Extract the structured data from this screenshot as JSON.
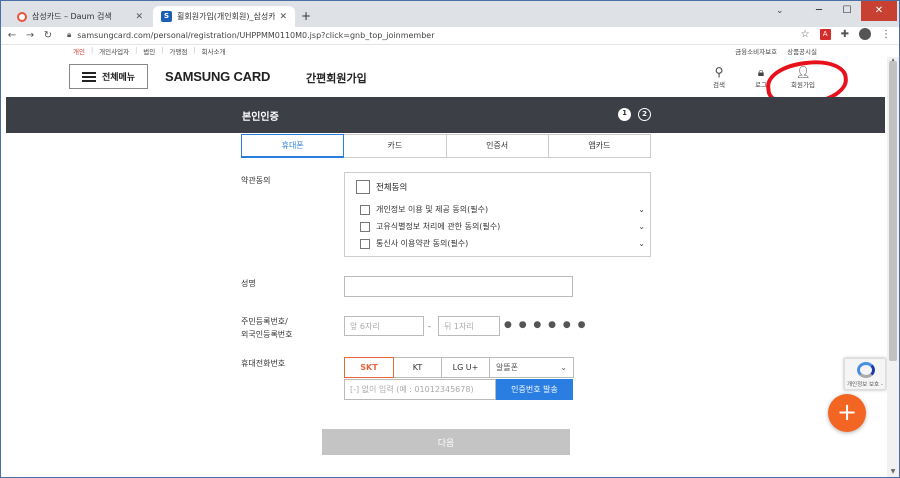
{
  "browser": {
    "tabs": [
      {
        "title": "삼성카드 – Daum 검색",
        "active": false
      },
      {
        "title": "휠회원가입(개인회원)_삼성카드",
        "active": true
      }
    ],
    "new_tab": "+",
    "url": "samsungcard.com/personal/registration/UHPPMM0110M0.jsp?click=gnb_top_joinmember"
  },
  "top_links": {
    "left": [
      "개인",
      "개인사업자",
      "법인",
      "가맹점",
      "회사소개"
    ],
    "right": [
      "금융소비자보호",
      "상품공시실"
    ]
  },
  "header": {
    "menu_label": "전체메뉴",
    "logo": "SAMSUNG CARD",
    "page_title": "간편회원가입",
    "icons": [
      {
        "label": "검색",
        "icon": "search-icon"
      },
      {
        "label": "로그",
        "icon": "lock-icon"
      },
      {
        "label": "회원가입",
        "icon": "person-add-icon"
      }
    ]
  },
  "section": {
    "title": "본인인증",
    "steps": [
      "1",
      "2"
    ]
  },
  "auth_tabs": [
    "휴대폰",
    "카드",
    "인증서",
    "앱카드"
  ],
  "form": {
    "terms_label": "약관동의",
    "agree_all": "전체동의",
    "terms": [
      "개인정보 이용 및 제공 동의(필수)",
      "고유식별정보 처리에 관한 동의(필수)",
      "통신사 이용약관 동의(필수)"
    ],
    "name_label": "성명",
    "rrn_label_1": "주민등록번호/",
    "rrn_label_2": "외국인등록번호",
    "rrn_front_placeholder": "앞 6자리",
    "rrn_dash": "-",
    "rrn_back_placeholder": "뒤 1자리",
    "rrn_mask": "● ● ● ● ● ●",
    "phone_label": "휴대전화번호",
    "carriers": [
      "SKT",
      "KT",
      "LG U+"
    ],
    "carrier_select": "알뜰폰",
    "phone_placeholder": "[-] 없이 입력 (예 : 01012345678)",
    "send_button": "인증번호 발송",
    "next_button": "다음"
  },
  "recaptcha_text": "개인정보 보호 -",
  "fab_label": "+"
}
